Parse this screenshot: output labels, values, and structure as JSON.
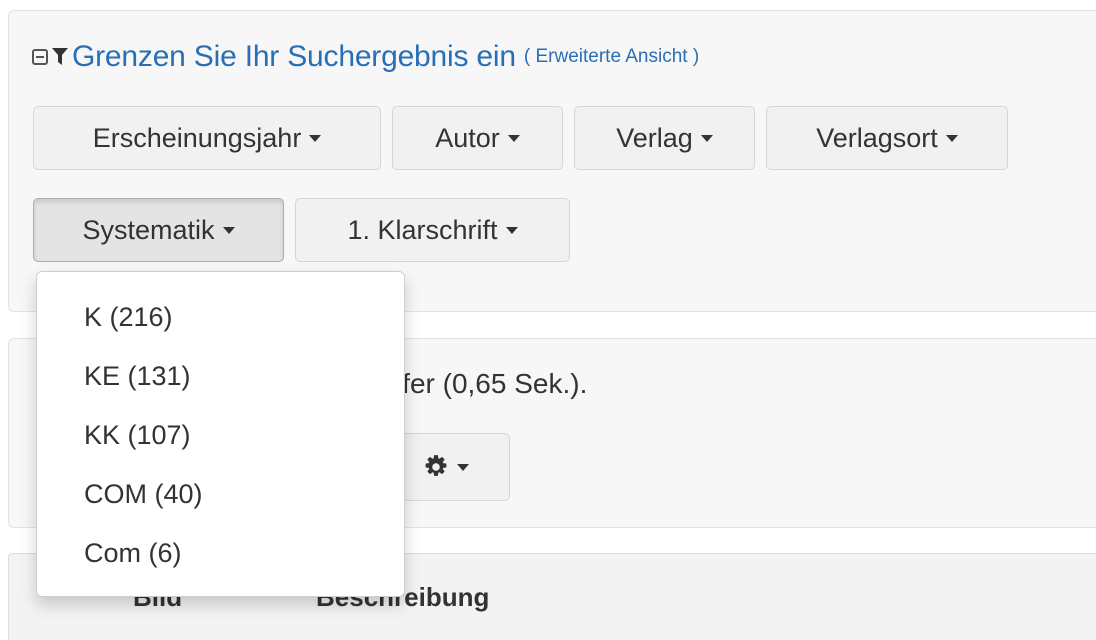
{
  "filter": {
    "heading": "Grenzen Sie Ihr Suchergebnis ein",
    "paren_open": "(",
    "advanced_link": "Erweiterte Ansicht",
    "paren_close": ")"
  },
  "facets": [
    {
      "label": "Erscheinungsjahr"
    },
    {
      "label": "Autor"
    },
    {
      "label": "Verlag"
    },
    {
      "label": "Verlagsort"
    },
    {
      "label": "Systematik",
      "active": true
    },
    {
      "label": "1. Klarschrift"
    }
  ],
  "dropdown": {
    "items": [
      {
        "label": "K (216)"
      },
      {
        "label": "KE (131)"
      },
      {
        "label": "KK (107)"
      },
      {
        "label": "COM (40)"
      },
      {
        "label": "Com (6)"
      }
    ]
  },
  "results": {
    "summary_visible": "reffer (0,65 Sek.)."
  },
  "table": {
    "columns": [
      "Bild",
      "Beschreibung"
    ]
  },
  "icons": {
    "collapse": "minus-square-icon",
    "filter": "filter-icon",
    "settings": "gear-icon",
    "dropdown": "caret-down-icon"
  },
  "colors": {
    "link": "#2a6fb5",
    "panel_bg": "#f7f7f7",
    "button_bg": "#f1f1f1"
  }
}
